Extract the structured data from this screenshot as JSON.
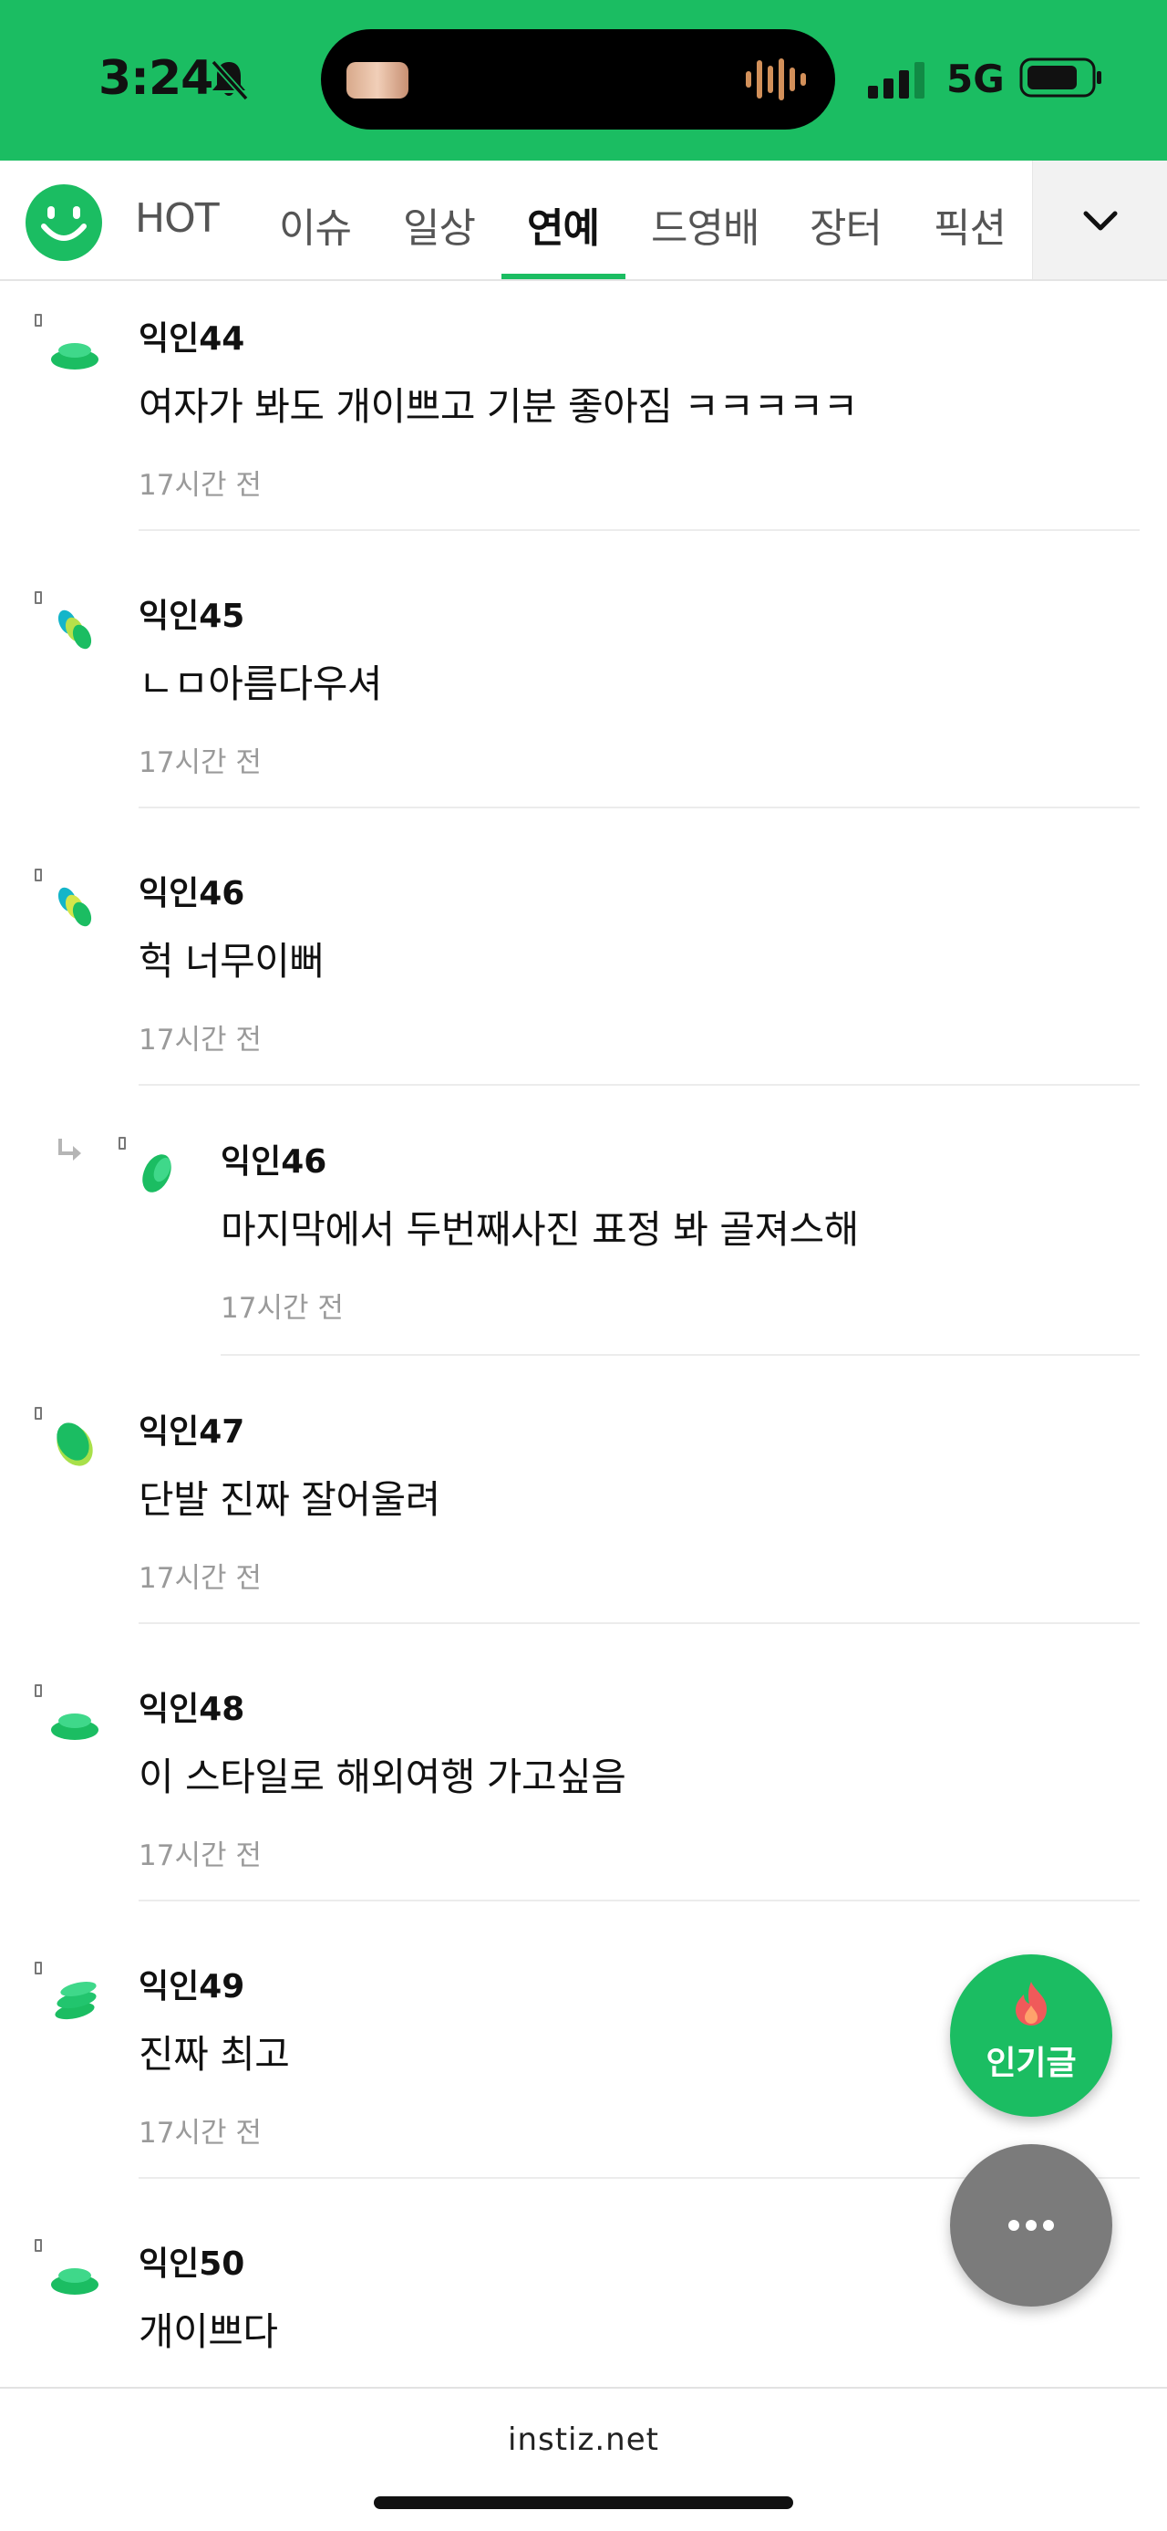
{
  "status_bar": {
    "time": "3:24",
    "network": "5G",
    "icons": [
      "bell-slash-icon",
      "audio-waveform-icon",
      "cellular-signal-icon",
      "battery-icon"
    ]
  },
  "nav": {
    "tabs": [
      {
        "label": "HOT"
      },
      {
        "label": "이슈"
      },
      {
        "label": "일상"
      },
      {
        "label": "연예"
      },
      {
        "label": "드영배"
      },
      {
        "label": "장터"
      },
      {
        "label": "픽션"
      }
    ],
    "active_tab": "연예",
    "more_icon": "chevron-down-icon"
  },
  "comments": [
    {
      "name": "익인44",
      "text": "여자가 봐도 개이쁘고 기분 좋아짐 ㅋㅋㅋㅋㅋ",
      "time": "17시간 전",
      "reply": false
    },
    {
      "name": "익인45",
      "text": "ㄴㅁ아름다우셔",
      "time": "17시간 전",
      "reply": false
    },
    {
      "name": "익인46",
      "text": "헉 너무이뻐",
      "time": "17시간 전",
      "reply": false
    },
    {
      "name": "익인46",
      "text": "마지막에서 두번째사진 표정 봐 골져스해",
      "time": "17시간 전",
      "reply": true
    },
    {
      "name": "익인47",
      "text": "단발 진짜 잘어울려",
      "time": "17시간 전",
      "reply": false
    },
    {
      "name": "익인48",
      "text": "이 스타일로 해외여행 가고싶음",
      "time": "17시간 전",
      "reply": false
    },
    {
      "name": "익인49",
      "text": "진짜 최고",
      "time": "17시간 전",
      "reply": false
    },
    {
      "name": "익인50",
      "text": "개이쁘다",
      "time": "",
      "reply": false
    }
  ],
  "fab": {
    "popular_label": "인기글",
    "popular_icon": "flame-icon",
    "more_icon": "more-dots-icon"
  },
  "footer": {
    "site": "instiz.net"
  },
  "colors": {
    "brand_green": "#1bbd62",
    "fab_gray": "#7b7b7b",
    "meta_gray": "#9a9a9a"
  }
}
